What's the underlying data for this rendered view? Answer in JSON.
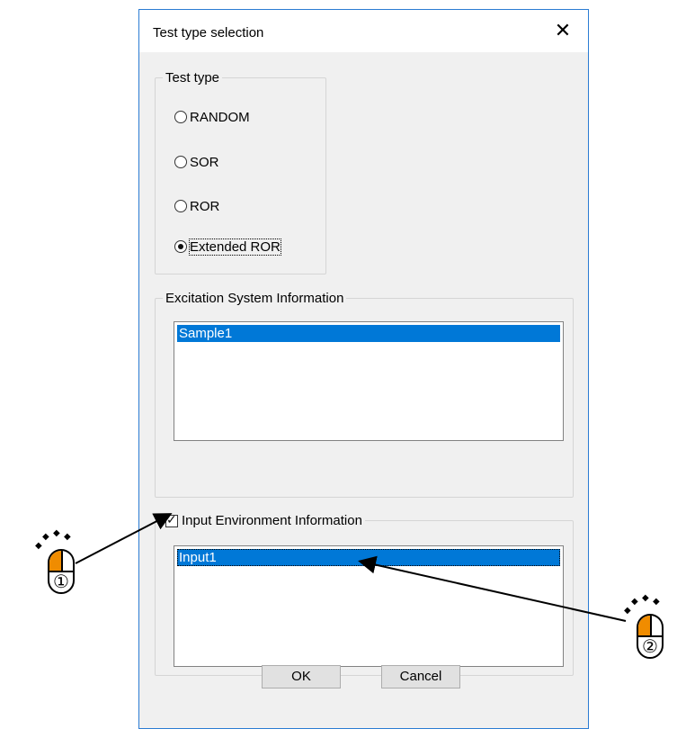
{
  "dialog": {
    "title": "Test type selection",
    "close_glyph": "✕"
  },
  "test_type": {
    "legend": "Test type",
    "options": [
      {
        "label": "RANDOM",
        "checked": false
      },
      {
        "label": "SOR",
        "checked": false
      },
      {
        "label": "ROR",
        "checked": false
      },
      {
        "label": "Extended ROR",
        "checked": true
      }
    ]
  },
  "excitation": {
    "legend": "Excitation System Information",
    "items": [
      "Sample1"
    ],
    "selected_index": 0
  },
  "input_env": {
    "legend": "Input Environment Information",
    "checked": true,
    "items": [
      "Input1"
    ],
    "selected_index": 0
  },
  "buttons": {
    "ok": "OK",
    "cancel": "Cancel"
  },
  "annotations": {
    "step1": "①",
    "step2": "②",
    "accent_color": "#f08c00"
  },
  "colors": {
    "selection": "#0078d7",
    "dialog_bg": "#f0f0f0",
    "border_accent": "#2b7cd3"
  }
}
